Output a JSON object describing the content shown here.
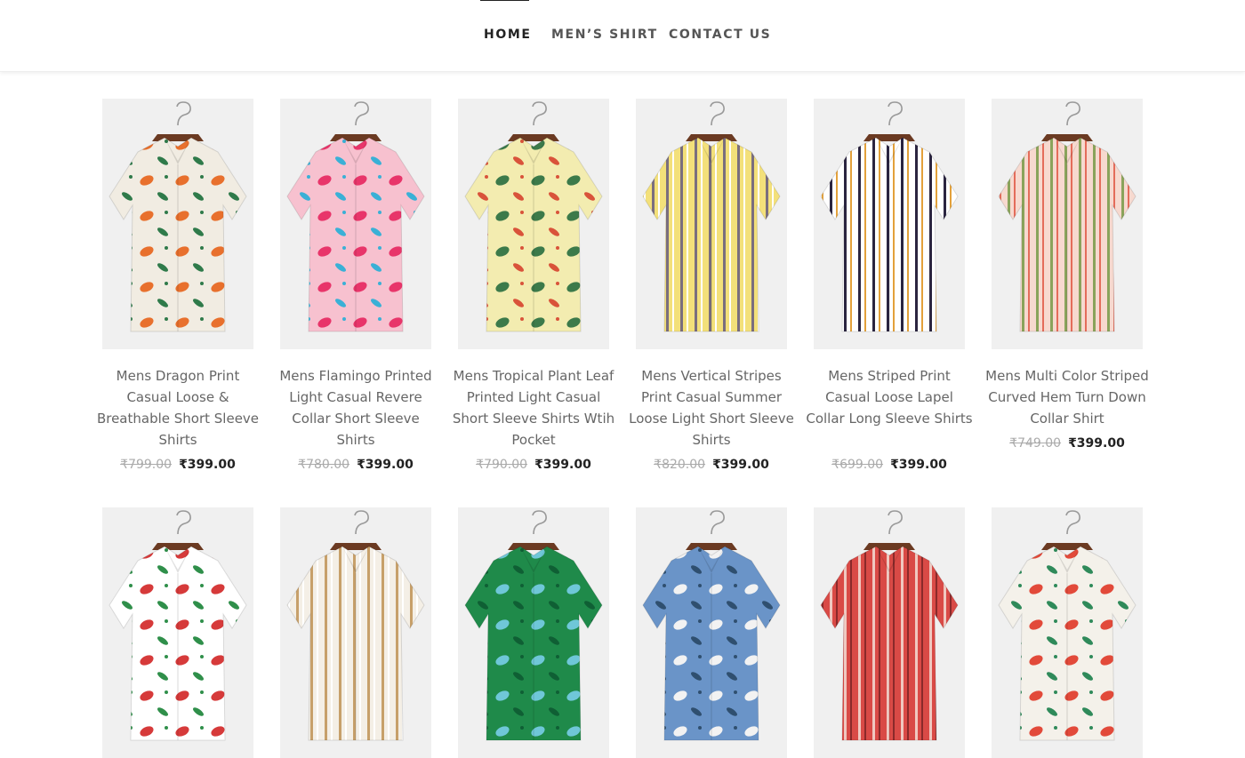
{
  "nav": {
    "items": [
      {
        "label": "HOME",
        "active": true
      },
      {
        "label": "MEN’S SHIRT",
        "active": false
      },
      {
        "label": "CONTACT US",
        "active": false
      }
    ]
  },
  "products": [
    {
      "title": "Mens Dragon Print Casual Loose & Breathable Short Sleeve Shirts",
      "old_price": "₹799.00",
      "price": "₹399.00",
      "bg": "#f1ece2",
      "accent": "#e8702d",
      "accent2": "#2f7a4a",
      "style": "print"
    },
    {
      "title": "Mens Flamingo Printed Light Casual Revere Collar Short Sleeve Shirts",
      "old_price": "₹780.00",
      "price": "₹399.00",
      "bg": "#f7c1cf",
      "accent": "#e8356a",
      "accent2": "#3ab0d6",
      "style": "print"
    },
    {
      "title": "Mens Tropical Plant Leaf Printed Light Casual Short Sleeve Shirts Wtih Pocket",
      "old_price": "₹790.00",
      "price": "₹399.00",
      "bg": "#f3ecb0",
      "accent": "#3c7a4a",
      "accent2": "#d9533a",
      "style": "print"
    },
    {
      "title": "Mens Vertical Stripes Print Casual Summer Loose Light Short Sleeve Shirts",
      "old_price": "₹820.00",
      "price": "₹399.00",
      "bg": "#f3e07a",
      "accent": "#7a6e7e",
      "accent2": "#ffffff",
      "style": "stripe"
    },
    {
      "title": "Mens Striped Print Casual Loose Lapel Collar Long Sleeve Shirts",
      "old_price": "₹699.00",
      "price": "₹399.00",
      "bg": "#ffffff",
      "accent": "#2b2540",
      "accent2": "#e3a13b",
      "style": "stripe"
    },
    {
      "title": "Mens Multi Color Striped Curved Hem Turn Down Collar Shirt",
      "old_price": "₹749.00",
      "price": "₹399.00",
      "bg": "#f7d9cf",
      "accent": "#8aa35b",
      "accent2": "#e46c5a",
      "style": "stripe"
    },
    {
      "title": "",
      "old_price": "",
      "price": "",
      "bg": "#ffffff",
      "accent": "#d63a3a",
      "accent2": "#2f8f4a",
      "style": "print"
    },
    {
      "title": "",
      "old_price": "",
      "price": "",
      "bg": "#f4efe6",
      "accent": "#c7a06a",
      "accent2": "#ffffff",
      "style": "stripe"
    },
    {
      "title": "",
      "old_price": "",
      "price": "",
      "bg": "#1f8a4a",
      "accent": "#6fc7d8",
      "accent2": "#0f5f34",
      "style": "print"
    },
    {
      "title": "",
      "old_price": "",
      "price": "",
      "bg": "#6a94c8",
      "accent": "#f2f2f2",
      "accent2": "#2f4f6f",
      "style": "print"
    },
    {
      "title": "",
      "old_price": "",
      "price": "",
      "bg": "#d94a46",
      "accent": "#f0c8c0",
      "accent2": "#8a2a2a",
      "style": "stripe"
    },
    {
      "title": "",
      "old_price": "",
      "price": "",
      "bg": "#f4f1ea",
      "accent": "#e24a3a",
      "accent2": "#2f8a5a",
      "style": "print"
    }
  ]
}
